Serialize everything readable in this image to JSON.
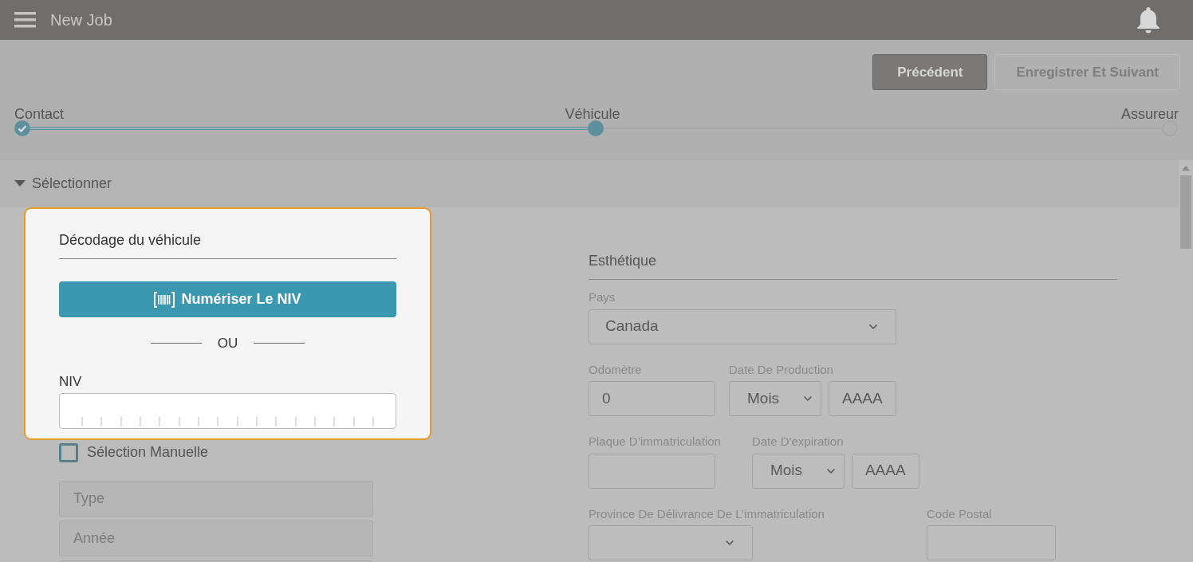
{
  "header": {
    "title": "New Job"
  },
  "actions": [
    {
      "label": "Précédent",
      "disabled": false
    },
    {
      "label": "Enregistrer Et Suivant",
      "disabled": true
    }
  ],
  "stepper": [
    {
      "label": "Contact",
      "done": true,
      "selected": false
    },
    {
      "label": "Véhicule",
      "done": false,
      "selected": true
    },
    {
      "label": "Assureur",
      "done": false,
      "selected": false
    }
  ],
  "section": {
    "title": "Sélectionner",
    "expanded": true
  },
  "vin_card": {
    "title": "Décodage du véhicule",
    "scan_button": "Numériser Le NIV",
    "separator": "OU",
    "vin_label": "NIV"
  },
  "manual_selection": {
    "label": "Sélection Manuelle",
    "checked": false
  },
  "manual_fields": [
    {
      "placeholder": "Type",
      "disabled": true
    },
    {
      "placeholder": "Année",
      "disabled": true
    },
    {
      "disabled": true
    }
  ],
  "aesthetics": {
    "title": "Esthétique",
    "rows": [
      [
        {
          "label": "Pays",
          "kind": "select",
          "value": "Canada"
        }
      ],
      [
        {
          "label": "Odomètre",
          "kind": "input",
          "value": "0"
        },
        {
          "label": "Date De Production",
          "kind": "date",
          "month": "Mois",
          "year_placeholder": "AAAA"
        }
      ],
      [
        {
          "label": "Plaque D’immatriculation",
          "kind": "input"
        },
        {
          "label": "Date D'expiration",
          "kind": "date",
          "month": "Mois",
          "year_placeholder": "AAAA"
        }
      ],
      [
        {
          "label": "Province De Délivrance De L’immatriculation",
          "kind": "select"
        },
        {
          "label": "Code Postal",
          "kind": "input"
        }
      ]
    ]
  }
}
